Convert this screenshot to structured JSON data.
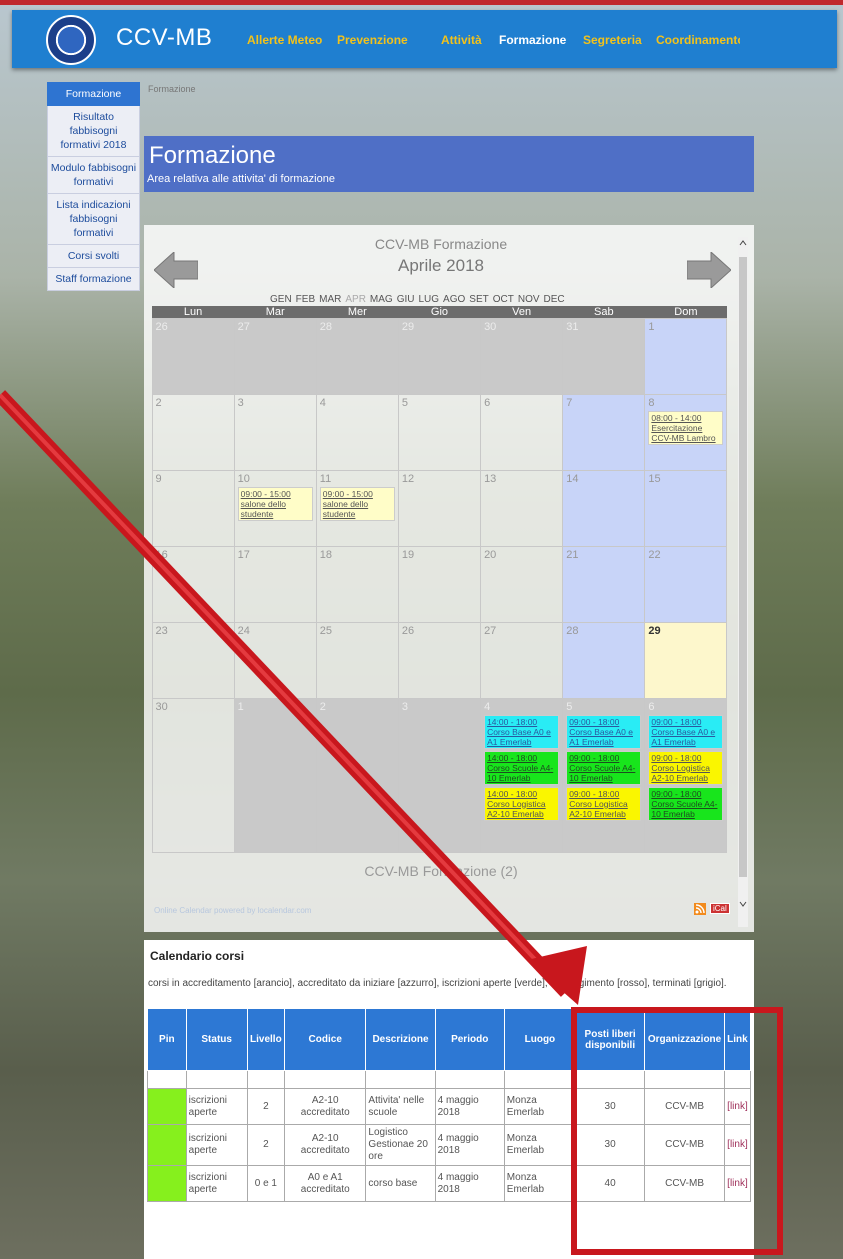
{
  "colors": {
    "header": "#1f7fd0",
    "nav_gold": "#f2c21b",
    "annotation": "#c8171d",
    "pin_green": "#86f01d"
  },
  "header": {
    "brand": "CCV-MB",
    "nav": [
      {
        "label": "Allerte Meteo"
      },
      {
        "label": "Prevenzione"
      },
      {
        "label": "Attività"
      },
      {
        "label": "Formazione"
      },
      {
        "label": "Segreteria"
      },
      {
        "label": "Coordinamento"
      }
    ]
  },
  "sidebar": {
    "items": [
      {
        "label": "Formazione"
      },
      {
        "label": "Risultato fabbisogni formativi 2018"
      },
      {
        "label": "Modulo fabbisogni formativi"
      },
      {
        "label": "Lista indicazioni fabbisogni formativi"
      },
      {
        "label": "Corsi svolti"
      },
      {
        "label": "Staff formazione"
      }
    ]
  },
  "breadcrumb": "Formazione",
  "page": {
    "title": "Formazione",
    "subtitle": "Area relativa alle attivita' di formazione"
  },
  "calendar": {
    "title": "CCV-MB Formazione",
    "month": "Aprile 2018",
    "months": [
      "GEN",
      "FEB",
      "MAR",
      "APR",
      "MAG",
      "GIU",
      "LUG",
      "AGO",
      "SET",
      "OCT",
      "NOV",
      "DEC"
    ],
    "weekdays": [
      "Lun",
      "Mar",
      "Mer",
      "Gio",
      "Ven",
      "Sab",
      "Dom"
    ],
    "footer": "CCV-MB Formazione (2)",
    "powered": "Online Calendar powered by localendar.com",
    "ical": "iCal",
    "weeks": [
      [
        {
          "d": "26",
          "t": "off"
        },
        {
          "d": "27",
          "t": "off"
        },
        {
          "d": "28",
          "t": "off"
        },
        {
          "d": "29",
          "t": "off"
        },
        {
          "d": "30",
          "t": "off"
        },
        {
          "d": "31",
          "t": "off"
        },
        {
          "d": "1",
          "t": "we"
        }
      ],
      [
        {
          "d": "2"
        },
        {
          "d": "3"
        },
        {
          "d": "4"
        },
        {
          "d": "5"
        },
        {
          "d": "6"
        },
        {
          "d": "7",
          "t": "we"
        },
        {
          "d": "8",
          "t": "we",
          "ev": [
            {
              "c": "yel",
              "x": "08:00 - 14:00 Esercitazione CCV-MB Lambro"
            }
          ]
        }
      ],
      [
        {
          "d": "9"
        },
        {
          "d": "10",
          "ev": [
            {
              "c": "yel",
              "x": "09:00 - 15:00 salone dello studente"
            }
          ]
        },
        {
          "d": "11",
          "ev": [
            {
              "c": "yel",
              "x": "09:00 - 15:00 salone dello studente"
            }
          ]
        },
        {
          "d": "12"
        },
        {
          "d": "13"
        },
        {
          "d": "14",
          "t": "we"
        },
        {
          "d": "15",
          "t": "we"
        }
      ],
      [
        {
          "d": "16"
        },
        {
          "d": "17"
        },
        {
          "d": "18"
        },
        {
          "d": "19"
        },
        {
          "d": "20"
        },
        {
          "d": "21",
          "t": "we"
        },
        {
          "d": "22",
          "t": "we"
        }
      ],
      [
        {
          "d": "23"
        },
        {
          "d": "24"
        },
        {
          "d": "25"
        },
        {
          "d": "26"
        },
        {
          "d": "27"
        },
        {
          "d": "28",
          "t": "we"
        },
        {
          "d": "29",
          "t": "today"
        }
      ],
      [
        {
          "d": "30"
        },
        {
          "d": "1",
          "t": "off"
        },
        {
          "d": "2",
          "t": "off"
        },
        {
          "d": "3",
          "t": "off"
        },
        {
          "d": "4",
          "t": "off",
          "ev": [
            {
              "c": "cy",
              "x": "14:00 - 18:00 Corso Base A0 e A1 Emerlab"
            },
            {
              "c": "gr",
              "x": "14:00 - 18:00 Corso Scuole A4-10 Emerlab"
            },
            {
              "c": "yy",
              "x": "14:00 - 18:00 Corso Logistica A2-10 Emerlab"
            }
          ]
        },
        {
          "d": "5",
          "t": "off",
          "ev": [
            {
              "c": "cy",
              "x": "09:00 - 18:00 Corso Base A0 e A1 Emerlab"
            },
            {
              "c": "gr",
              "x": "09:00 - 18:00 Corso Scuole A4-10 Emerlab"
            },
            {
              "c": "yy",
              "x": "09:00 - 18:00 Corso Logistica A2-10 Emerlab"
            }
          ]
        },
        {
          "d": "6",
          "t": "off",
          "ev": [
            {
              "c": "cy",
              "x": "09:00 - 18:00 Corso Base A0 e A1 Emerlab"
            },
            {
              "c": "yy",
              "x": "09:00 - 18:00 Corso Logistica A2-10 Emerlab"
            },
            {
              "c": "gr",
              "x": "09:00 - 18:00 Corso Scuole A4-10 Emerlab"
            }
          ]
        }
      ]
    ]
  },
  "corsi": {
    "title": "Calendario corsi",
    "note": "corsi in accreditamento [arancio], accreditato da iniziare [azzurro], iscrizioni aperte [verde], in svolgimento [rosso], terminati [grigio].",
    "headers": [
      "Pin",
      "Status",
      "Livello",
      "Codice",
      "Descrizione",
      "Periodo",
      "Luogo",
      "Posti liberi disponibili",
      "Organizzazione",
      "Link"
    ],
    "rows": [
      [
        "",
        "iscrizioni aperte",
        "2",
        "A2-10 accreditato",
        "Attivita' nelle scuole",
        "4 maggio 2018",
        "Monza Emerlab",
        "30",
        "CCV-MB",
        "[link]"
      ],
      [
        "",
        "iscrizioni aperte",
        "2",
        "A2-10 accreditato",
        "Logistico Gestionae 20 ore",
        "4 maggio 2018",
        "Monza Emerlab",
        "30",
        "CCV-MB",
        "[link]"
      ],
      [
        "",
        "iscrizioni aperte",
        "0 e 1",
        "A0 e A1 accreditato",
        "corso base",
        "4 maggio 2018",
        "Monza Emerlab",
        "40",
        "CCV-MB",
        "[link]"
      ]
    ]
  }
}
